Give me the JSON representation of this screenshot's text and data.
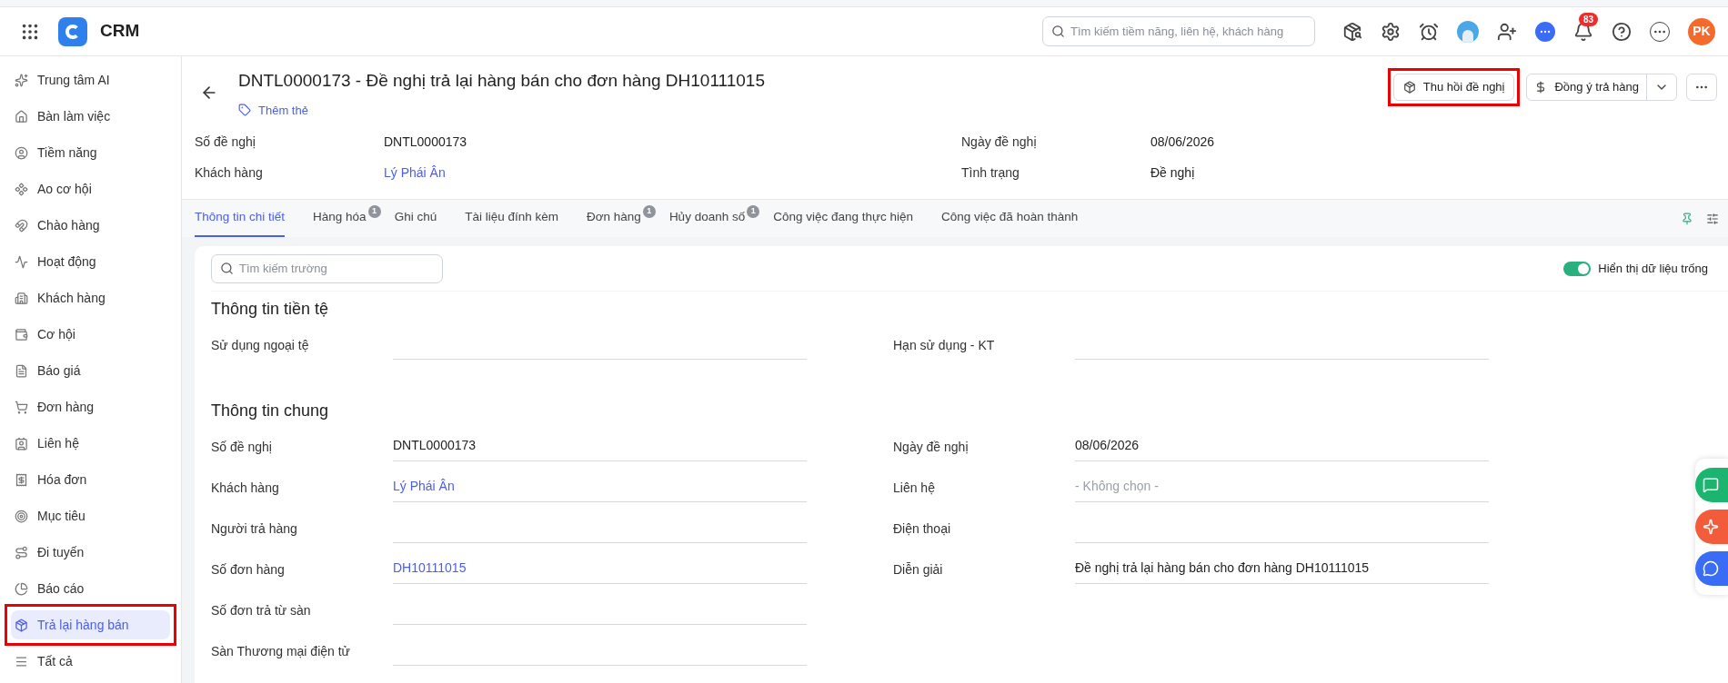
{
  "app": {
    "name": "CRM",
    "search_placeholder": "Tìm kiếm tiềm năng, liên hệ, khách hàng",
    "notification_count": "83",
    "avatar_initials": "PK"
  },
  "sidebar": {
    "items": [
      {
        "label": "Trung tâm AI",
        "selected": false,
        "highlighted": false
      },
      {
        "label": "Bàn làm việc",
        "selected": false,
        "highlighted": false
      },
      {
        "label": "Tiềm năng",
        "selected": false,
        "highlighted": false
      },
      {
        "label": "Ao cơ hội",
        "selected": false,
        "highlighted": false
      },
      {
        "label": "Chào hàng",
        "selected": false,
        "highlighted": false
      },
      {
        "label": "Hoạt động",
        "selected": false,
        "highlighted": false
      },
      {
        "label": "Khách hàng",
        "selected": false,
        "highlighted": false
      },
      {
        "label": "Cơ hội",
        "selected": false,
        "highlighted": false
      },
      {
        "label": "Báo giá",
        "selected": false,
        "highlighted": false
      },
      {
        "label": "Đơn hàng",
        "selected": false,
        "highlighted": false
      },
      {
        "label": "Liên hệ",
        "selected": false,
        "highlighted": false
      },
      {
        "label": "Hóa đơn",
        "selected": false,
        "highlighted": false
      },
      {
        "label": "Mục tiêu",
        "selected": false,
        "highlighted": false
      },
      {
        "label": "Đi tuyến",
        "selected": false,
        "highlighted": false
      },
      {
        "label": "Báo cáo",
        "selected": false,
        "highlighted": false
      },
      {
        "label": "Trả lại hàng bán",
        "selected": true,
        "highlighted": true
      },
      {
        "label": "Tất cả",
        "selected": false,
        "highlighted": false
      }
    ]
  },
  "record": {
    "title": "DNTL0000173 - Đề nghị trả lại hàng bán cho đơn hàng DH10111015",
    "add_tag": "Thêm thẻ",
    "actions": [
      {
        "label": "Thu hồi đề nghị",
        "highlighted": true
      },
      {
        "label": "Đồng ý trả hàng",
        "highlighted": false
      }
    ],
    "summary": [
      {
        "label": "Số đề nghị",
        "value": "DNTL0000173",
        "link": false
      },
      {
        "label": "Ngày đề nghị",
        "value": "08/06/2026",
        "link": false
      },
      {
        "label": "Khách hàng",
        "value": "Lý Phái Ân",
        "link": true
      },
      {
        "label": "Tình trạng",
        "value": "Đề nghị",
        "link": false
      }
    ]
  },
  "tabs": [
    {
      "label": "Thông tin chi tiết",
      "selected": true
    },
    {
      "label": "Hàng hóa",
      "badge": "1",
      "selected": false
    },
    {
      "label": "Ghi chú",
      "selected": false
    },
    {
      "label": "Tài liệu đính kèm",
      "selected": false
    },
    {
      "label": "Đơn hàng",
      "badge": "1",
      "selected": false
    },
    {
      "label": "Hủy doanh số",
      "badge": "1",
      "selected": false
    },
    {
      "label": "Công việc đang thực hiện",
      "selected": false
    },
    {
      "label": "Công việc đã hoàn thành",
      "selected": false
    }
  ],
  "detail": {
    "search_placeholder": "Tìm kiếm trường",
    "show_empty": {
      "label": "Hiển thị dữ liệu trống",
      "on": true
    },
    "sections": [
      {
        "title": "Thông tin tiền tệ",
        "left": [
          {
            "label": "Sử dụng ngoại tệ"
          }
        ],
        "right": [
          {
            "label": "Hạn sử dụng - KT"
          }
        ]
      },
      {
        "title": "Thông tin chung",
        "left": [
          {
            "label": "Số đề nghị",
            "value": "DNTL0000173",
            "link": false
          },
          {
            "label": "Khách hàng",
            "value": "Lý Phái Ân",
            "link": true
          },
          {
            "label": "Người trả hàng"
          },
          {
            "label": "Số đơn hàng",
            "value": "DH10111015",
            "link": true
          },
          {
            "label": "Số đơn trả từ sàn"
          },
          {
            "label": "Sàn Thương mại điện tử"
          }
        ],
        "right": [
          {
            "label": "Ngày đề nghị",
            "value": "08/06/2026",
            "link": false
          },
          {
            "label": "Liên hệ",
            "placeholder": "- Không chọn -"
          },
          {
            "label": "Điện thoại"
          },
          {
            "label": "Diễn giải",
            "value": "Đề nghị trả lại hàng bán cho đơn hàng DH10111015",
            "link": false
          }
        ]
      }
    ]
  }
}
